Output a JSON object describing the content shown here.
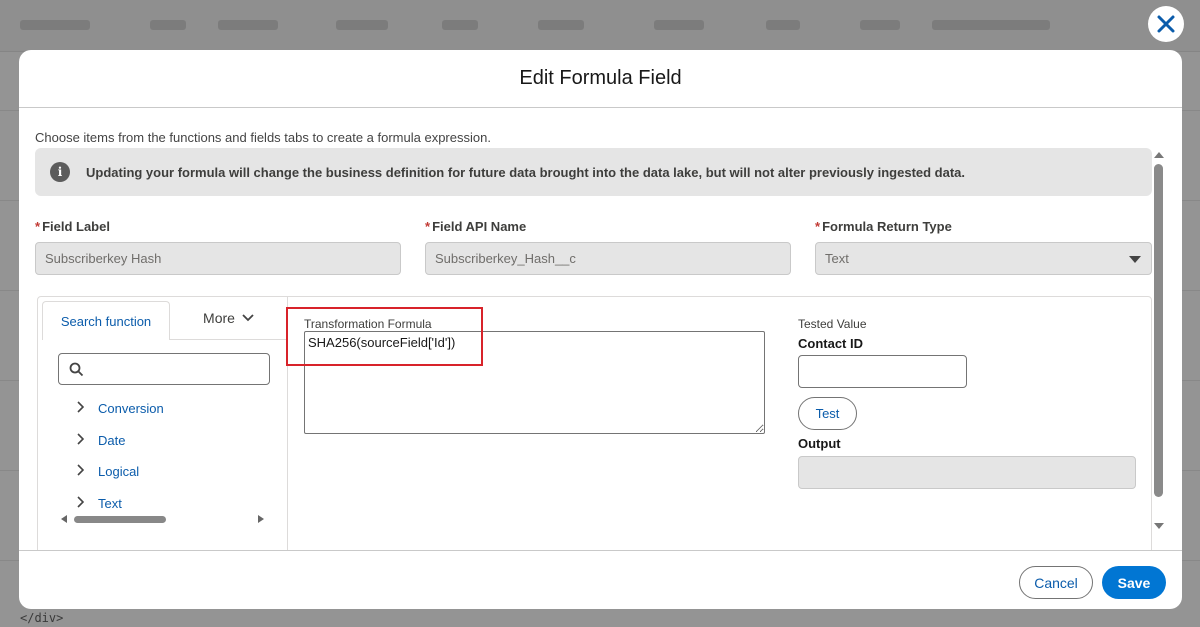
{
  "background": {
    "code_fragment": "</div>"
  },
  "modal": {
    "title": "Edit Formula Field",
    "instructions": "Choose items from the functions and fields tabs to create a formula expression.",
    "alert_text": "Updating your formula will change the business definition for future data brought into the data lake, but will not alter previously ingested data.",
    "fields": {
      "label": {
        "label": "Field Label",
        "value": "Subscriberkey Hash",
        "required": "*"
      },
      "api_name": {
        "label": "Field API Name",
        "value": "Subscriberkey_Hash__c",
        "required": "*"
      },
      "return_type": {
        "label": "Formula Return Type",
        "value": "Text",
        "required": "*"
      }
    },
    "functions_panel": {
      "tabs": [
        "Search function",
        "More"
      ],
      "search_placeholder": "",
      "categories": [
        "Conversion",
        "Date",
        "Logical",
        "Text"
      ]
    },
    "formula": {
      "label": "Transformation Formula",
      "value": "SHA256(sourceField['Id'])"
    },
    "tester": {
      "tested_value_label": "Tested Value",
      "contact_label": "Contact ID",
      "contact_value": "",
      "test_button": "Test",
      "output_label": "Output",
      "output_value": ""
    },
    "footer": {
      "cancel": "Cancel",
      "save": "Save"
    }
  },
  "colors": {
    "brand": "#0176d3",
    "link": "#0b5cab",
    "highlight": "#d8232a"
  }
}
